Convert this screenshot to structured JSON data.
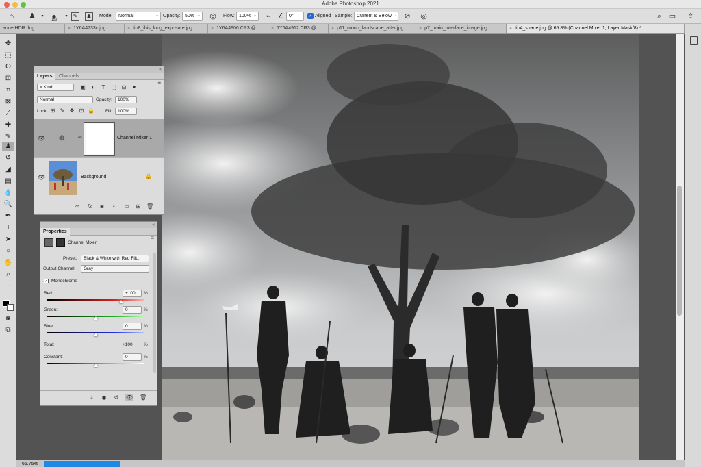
{
  "window": {
    "title": "Adobe Photoshop 2021"
  },
  "options_bar": {
    "mode_label": "Mode:",
    "mode_value": "Normal",
    "brush_size": "150",
    "opacity_label": "Opacity:",
    "opacity_value": "50%",
    "flow_label": "Flow:",
    "flow_value": "100%",
    "angle_value": "0°",
    "aligned_label": "Aligned",
    "sample_label": "Sample:",
    "sample_value": "Current & Below"
  },
  "tabs": [
    {
      "label": "ance-HDR.dng"
    },
    {
      "label": "1Y6A4733c.jpg ..."
    },
    {
      "label": "tip8_ibis_long_exposure.jpg"
    },
    {
      "label": "1Y6A4906.CR3 @..."
    },
    {
      "label": "1Y6A4912.CR3 @..."
    },
    {
      "label": "p11_mono_landscape_after.jpg"
    },
    {
      "label": "p7_main_interface_image.jpg"
    },
    {
      "label": "tip4_shade.jpg @ 65.8% (Channel Mixer 1, Layer Mask/8) *"
    }
  ],
  "layers_panel": {
    "tab_layers": "Layers",
    "tab_channels": "Channels",
    "kind_label": "Kind",
    "blend_mode": "Normal",
    "opacity_label": "Opacity:",
    "opacity_value": "100%",
    "lock_label": "Lock:",
    "fill_label": "Fill:",
    "fill_value": "100%",
    "layers": [
      {
        "name": "Channel Mixer 1"
      },
      {
        "name": "Background"
      }
    ],
    "fx_label": "fx"
  },
  "properties_panel": {
    "tab_properties": "Properties",
    "adjustment_name": "Channel Mixer",
    "preset_label": "Preset:",
    "preset_value": "Black & White with Red Filt...",
    "output_channel_label": "Output Channel:",
    "output_channel_value": "Gray",
    "monochrome_label": "Monochrome",
    "red_label": "Red:",
    "red_value": "+100",
    "green_label": "Green:",
    "green_value": "0",
    "blue_label": "Blue:",
    "blue_value": "0",
    "total_label": "Total:",
    "total_value": "+100",
    "constant_label": "Constant:",
    "constant_value": "0",
    "percent": "%"
  },
  "status": {
    "zoom": "65.75%"
  },
  "icons": [
    "home-icon",
    "clone-stamp-icon",
    "brush-preset-icon",
    "toggle-brush-panel-icon",
    "toggle-clone-source-icon",
    "pressure-opacity-icon",
    "airbrush-icon",
    "angle-icon",
    "ignore-adjustment-layers-icon",
    "pressure-size-icon",
    "search-icon",
    "workspace-icon",
    "share-icon",
    "eye-icon",
    "lock-icon",
    "link-icon",
    "mask-icon"
  ]
}
